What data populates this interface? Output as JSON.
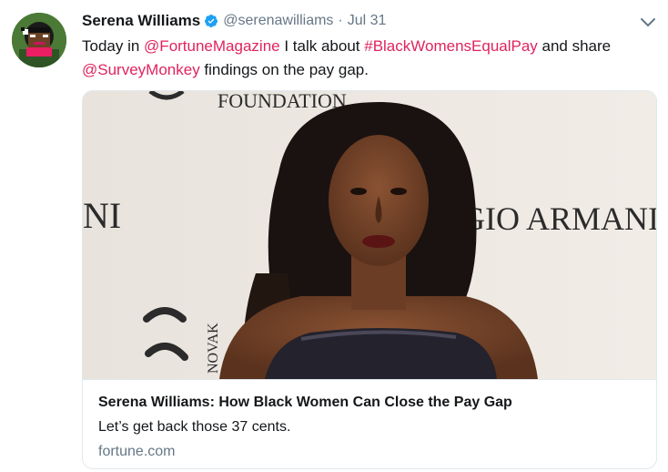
{
  "tweet": {
    "author_name": "Serena Williams",
    "handle": "@serenawilliams",
    "separator": "·",
    "timestamp": "Jul 31",
    "text_parts": [
      {
        "type": "text",
        "value": "Today in "
      },
      {
        "type": "link",
        "value": "@FortuneMagazine"
      },
      {
        "type": "text",
        "value": " I talk about "
      },
      {
        "type": "link",
        "value": "#BlackWomensEqualPay"
      },
      {
        "type": "text",
        "value": " and share "
      },
      {
        "type": "link",
        "value": "@SurveyMonkey"
      },
      {
        "type": "text",
        "value": " findings on the pay gap."
      }
    ]
  },
  "card": {
    "title": "Serena Williams: How Black Women Can Close the Pay Gap",
    "description": "Let’s get back those 37 cents.",
    "domain": "fortune.com",
    "image_backdrop_text": {
      "top": "FOUNDATION",
      "left": "NI",
      "right": "RGIO ARMANI",
      "vertical": "NOVAK"
    }
  },
  "colors": {
    "link": "#e0245e",
    "verified": "#1da1f2",
    "secondary_text": "#657786",
    "border": "#e1e8ed"
  },
  "icons": {
    "verified": "verified-badge-icon",
    "caret": "chevron-down-icon"
  }
}
